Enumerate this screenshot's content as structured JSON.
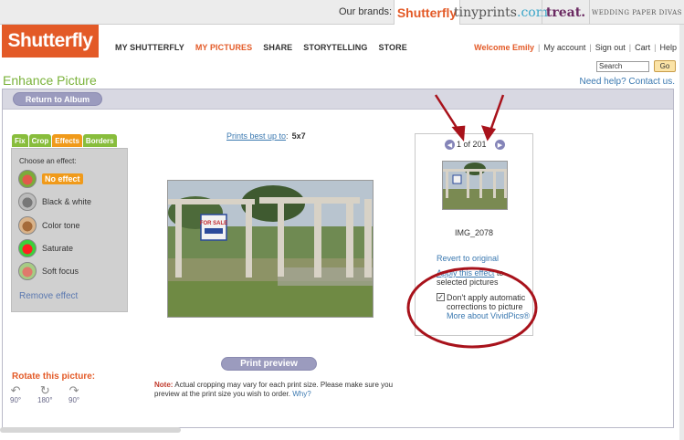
{
  "brandbar": {
    "label": "Our brands:",
    "brands": [
      "Shutterfly",
      "tinyprints",
      "treat.",
      "WEDDING PAPER DIVAS"
    ],
    "tiny_a": "tinyprints",
    "tiny_b": ".com"
  },
  "logo": "Shutterfly",
  "nav": [
    "MY SHUTTERFLY",
    "MY PICTURES",
    "SHARE",
    "STORYTELLING",
    "STORE"
  ],
  "account": {
    "welcome": "Welcome Emily",
    "links": [
      "My account",
      "Sign out",
      "Cart",
      "Help"
    ]
  },
  "search": {
    "placeholder": "Search",
    "go": "Go"
  },
  "help": "Need help? Contact us.",
  "page_title": "Enhance Picture",
  "return_btn": "Return to Album",
  "tabs": [
    "Fix",
    "Crop",
    "Effects",
    "Borders"
  ],
  "effects": {
    "header": "Choose an effect:",
    "items": [
      "No effect",
      "Black & white",
      "Color tone",
      "Saturate",
      "Soft focus"
    ],
    "remove": "Remove effect"
  },
  "rotate": {
    "title": "Rotate this picture:",
    "options": [
      "90°",
      "180°",
      "90°"
    ]
  },
  "prints": {
    "label": "Prints best up to",
    "colon": ":",
    "size": "5x7"
  },
  "preview_btn": "Print preview",
  "note": {
    "label": "Note:",
    "text": "Actual cropping may vary for each print size. Please make sure you preview at the print size you wish to order.",
    "why": "Why?"
  },
  "right": {
    "count": "1 of 201",
    "filename": "IMG_2078",
    "revert": "Revert to original",
    "apply_link": "Apply this effect",
    "apply_rest": "to selected pictures",
    "chk_text": "Don't apply automatic corrections to picture",
    "more_link": "More about VividPics®"
  },
  "sign": {
    "line1": "FOR SALE"
  },
  "colors": {
    "brand_orange": "#e35a27",
    "green": "#88bd3c",
    "annotation_red": "#a8121b"
  }
}
